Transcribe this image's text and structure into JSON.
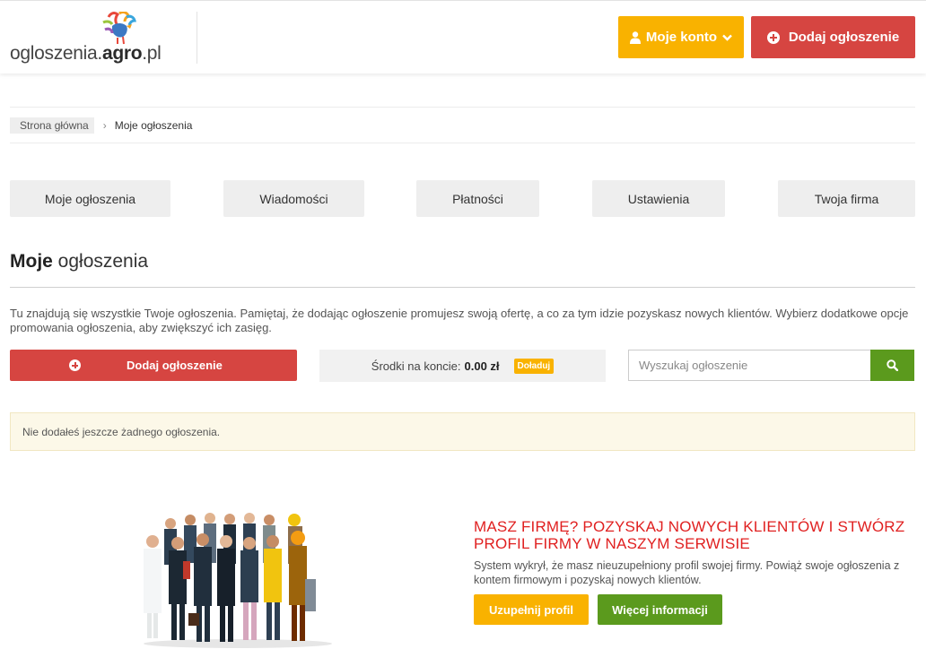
{
  "header": {
    "logo": {
      "text_main": "ogloszenia.",
      "text_accent": "agro",
      "text_end": ".pl"
    },
    "account_label": "Moje konto",
    "add_label": "Dodaj ogłoszenie"
  },
  "breadcrumb": {
    "home": "Strona główna",
    "separator": "›",
    "current": "Moje ogłoszenia"
  },
  "tabs": [
    {
      "label": "Moje ogłoszenia"
    },
    {
      "label": "Wiadomości"
    },
    {
      "label": "Płatności"
    },
    {
      "label": "Ustawienia"
    },
    {
      "label": "Twoja firma"
    }
  ],
  "page": {
    "title_bold": "Moje",
    "title_rest": " ogłoszenia",
    "intro": "Tu znajdują się wszystkie Twoje ogłoszenia. Pamiętaj, że dodając ogłoszenie promujesz swoją ofertę, a co za tym idzie pozyskasz nowych klientów. Wybierz dodatkowe opcje promowania ogłoszenia, aby zwiększyć ich zasięg."
  },
  "actions": {
    "add_label": "Dodaj ogłoszenie",
    "funds_label": "Środki na koncie:",
    "funds_amount": "0.00 zł",
    "topup_label": "Doładuj",
    "search_placeholder": "Wyszukaj ogłoszenie",
    "search_value": ""
  },
  "notice": {
    "text": "Nie dodałeś jeszcze żadnego ogłoszenia."
  },
  "promo": {
    "title": "MASZ FIRMĘ? POZYSKAJ NOWYCH KLIENTÓW I STWÓRZ PROFIL FIRMY W NASZYM SERWISIE",
    "text": "System wykrył, że masz nieuzupełniony profil swojej firmy. Powiąż swoje ogłoszenia z kontem firmowym i pozyskaj nowych klientów.",
    "complete_label": "Uzupełnij profil",
    "more_label": "Więcej informacji"
  },
  "colors": {
    "accent_yellow": "#f9b200",
    "accent_red": "#d64541",
    "accent_green": "#5b9a1d",
    "promo_red": "#e02020"
  },
  "icons": [
    "user-icon",
    "chevron-down-icon",
    "plus-circle-icon",
    "search-icon",
    "rooster-logo"
  ]
}
